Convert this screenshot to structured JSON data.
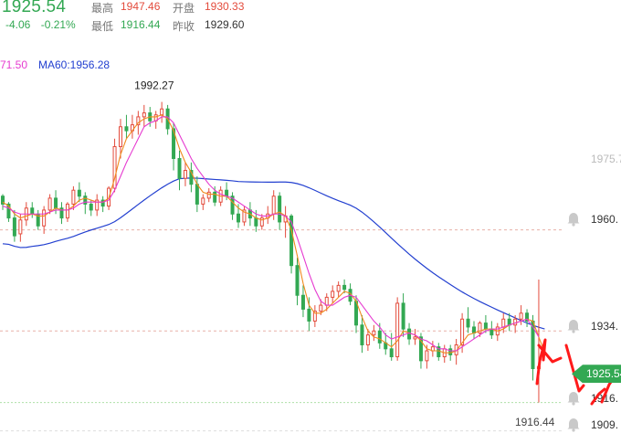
{
  "header": {
    "price": "1925.54",
    "change": "-4.06",
    "change_pct": "-0.21%",
    "high_label": "最高",
    "high": "1947.46",
    "low_label": "最低",
    "low": "1916.44",
    "open_label": "开盘",
    "open": "1930.33",
    "prev_close_label": "昨收",
    "prev_close": "1929.60"
  },
  "ma": {
    "ma_short_text": "71.50",
    "ma60_text": "MA60:1956.28"
  },
  "colors": {
    "up": "#e34b3c",
    "down": "#33a853",
    "ma_short": "#e63ad0",
    "ma_mid": "#f08a1e",
    "ma60": "#2340d0",
    "arrow": "#ff1a1a",
    "grid": "#e8b0a8",
    "bell": "#c9c9c9"
  },
  "chart_data": {
    "type": "candlestick",
    "y_range": [
      1906,
      2000
    ],
    "max_label": "1992.27",
    "min_label": "1916.44",
    "last_price_label": "1925.54",
    "right_axis_labels": [
      "1975.7",
      "1960.",
      "1934.",
      "1916.",
      "1909."
    ],
    "alert_levels": [
      1960.0,
      1934.5,
      1916.44,
      1909.3
    ],
    "candles": [
      [
        1968.5,
        1969,
        1965,
        1966.5
      ],
      [
        1966.5,
        1967,
        1962,
        1963
      ],
      [
        1963,
        1965,
        1957,
        1958.5
      ],
      [
        1959,
        1964,
        1957,
        1962.5
      ],
      [
        1962.5,
        1967,
        1961,
        1965.5
      ],
      [
        1965.5,
        1967,
        1963,
        1964
      ],
      [
        1964,
        1965,
        1960,
        1961
      ],
      [
        1961,
        1966,
        1959,
        1965
      ],
      [
        1965,
        1969,
        1964,
        1968
      ],
      [
        1968,
        1970,
        1964,
        1965.5
      ],
      [
        1965.5,
        1967,
        1961.5,
        1963
      ],
      [
        1963,
        1967,
        1962,
        1966.5
      ],
      [
        1966.5,
        1971,
        1965,
        1970
      ],
      [
        1970,
        1972,
        1967,
        1968.5
      ],
      [
        1968.5,
        1969.5,
        1964,
        1966.5
      ],
      [
        1966.5,
        1967.5,
        1963.5,
        1965
      ],
      [
        1965,
        1969,
        1963.5,
        1967.5
      ],
      [
        1967.5,
        1968.5,
        1964.5,
        1966
      ],
      [
        1966,
        1971,
        1965,
        1970.5
      ],
      [
        1970.5,
        1983,
        1969.5,
        1981
      ],
      [
        1981,
        1988,
        1978,
        1986
      ],
      [
        1986,
        1989,
        1983,
        1985
      ],
      [
        1985,
        1989,
        1983,
        1986.5
      ],
      [
        1986.5,
        1990,
        1984,
        1988.5
      ],
      [
        1988.5,
        1991.5,
        1986,
        1989.5
      ],
      [
        1989.5,
        1991,
        1986,
        1987.5
      ],
      [
        1987.5,
        1990,
        1985.5,
        1989
      ],
      [
        1989,
        1992.27,
        1987,
        1990.5
      ],
      [
        1990.5,
        1991.5,
        1984,
        1985.5
      ],
      [
        1985.5,
        1987,
        1975,
        1978
      ],
      [
        1978,
        1980,
        1970,
        1973
      ],
      [
        1973,
        1977,
        1971,
        1975
      ],
      [
        1975,
        1977,
        1969.5,
        1971.5
      ],
      [
        1971.5,
        1973.5,
        1964.5,
        1966.5
      ],
      [
        1966.5,
        1969,
        1965,
        1968
      ],
      [
        1968,
        1970.5,
        1967,
        1969.5
      ],
      [
        1969.5,
        1971,
        1966,
        1967
      ],
      [
        1967,
        1971,
        1966,
        1970
      ],
      [
        1970,
        1972,
        1967.5,
        1968.5
      ],
      [
        1968.5,
        1969.5,
        1962.5,
        1964
      ],
      [
        1964,
        1966.5,
        1960.5,
        1962
      ],
      [
        1962,
        1966,
        1961,
        1965
      ],
      [
        1965,
        1967,
        1961,
        1963
      ],
      [
        1963,
        1965,
        1959.5,
        1961
      ],
      [
        1961,
        1964,
        1960,
        1963
      ],
      [
        1963,
        1966,
        1961.5,
        1964
      ],
      [
        1964,
        1970,
        1962.5,
        1968.5
      ],
      [
        1968.5,
        1969.5,
        1960,
        1962
      ],
      [
        1962,
        1966,
        1958,
        1963.5
      ],
      [
        1963.5,
        1964,
        1949,
        1951
      ],
      [
        1951,
        1953,
        1941,
        1943.5
      ],
      [
        1943.5,
        1946,
        1938,
        1940
      ],
      [
        1940,
        1943,
        1934.5,
        1937
      ],
      [
        1937,
        1941,
        1935.5,
        1939.5
      ],
      [
        1939.5,
        1942.5,
        1938.5,
        1941
      ],
      [
        1941,
        1944,
        1939.5,
        1943
      ],
      [
        1943,
        1946,
        1941.5,
        1944.5
      ],
      [
        1944.5,
        1947,
        1943,
        1946
      ],
      [
        1946,
        1947.5,
        1944,
        1945
      ],
      [
        1945,
        1946.5,
        1941,
        1942
      ],
      [
        1942,
        1943.5,
        1934,
        1936
      ],
      [
        1936,
        1938.5,
        1929,
        1931
      ],
      [
        1931,
        1935,
        1929.5,
        1933.5
      ],
      [
        1933.5,
        1936,
        1932,
        1934.5
      ],
      [
        1934.5,
        1936.5,
        1930,
        1931.5
      ],
      [
        1931.5,
        1934,
        1928.5,
        1930
      ],
      [
        1930,
        1934,
        1927,
        1928
      ],
      [
        1928,
        1943,
        1927,
        1941.5
      ],
      [
        1941.5,
        1944,
        1933,
        1935
      ],
      [
        1935,
        1936.5,
        1931,
        1932.5
      ],
      [
        1932.5,
        1935,
        1931,
        1933
      ],
      [
        1933,
        1934,
        1925,
        1927
      ],
      [
        1927,
        1931,
        1925,
        1929.5
      ],
      [
        1929.5,
        1932,
        1928,
        1930.5
      ],
      [
        1930.5,
        1931.5,
        1927,
        1928
      ],
      [
        1928,
        1931,
        1926.5,
        1930
      ],
      [
        1930,
        1931,
        1927,
        1928.5
      ],
      [
        1928.5,
        1932.5,
        1926,
        1931
      ],
      [
        1931,
        1939,
        1929,
        1937.5
      ],
      [
        1937.5,
        1940.5,
        1934,
        1935.5
      ],
      [
        1935.5,
        1937,
        1932.5,
        1934
      ],
      [
        1934,
        1937,
        1933,
        1936.5
      ],
      [
        1936.5,
        1938.5,
        1934,
        1935
      ],
      [
        1935,
        1937,
        1932.5,
        1933.5
      ],
      [
        1933.5,
        1936.5,
        1932,
        1935.5
      ],
      [
        1935.5,
        1939,
        1934,
        1937.5
      ],
      [
        1937.5,
        1939,
        1934.5,
        1936
      ],
      [
        1936,
        1938.5,
        1934,
        1937.5
      ],
      [
        1937.5,
        1941,
        1936,
        1939
      ],
      [
        1939,
        1940,
        1935.5,
        1937
      ],
      [
        1937,
        1938.5,
        1922,
        1925
      ],
      [
        1925,
        1947.46,
        1916.44,
        1925.54
      ]
    ],
    "ma_short": [
      1966,
      1965.5,
      1964.5,
      1964,
      1964,
      1964,
      1964,
      1964,
      1964.5,
      1965,
      1965,
      1965,
      1965.5,
      1966.5,
      1967,
      1967,
      1967,
      1967,
      1967.5,
      1970,
      1973.5,
      1977,
      1980,
      1983,
      1986,
      1987,
      1987.5,
      1988.5,
      1988.5,
      1987,
      1984,
      1981,
      1978,
      1975.5,
      1973.5,
      1971.5,
      1970,
      1969,
      1968.5,
      1968,
      1967,
      1966,
      1965,
      1964,
      1963.5,
      1963.5,
      1964,
      1964,
      1963.5,
      1962,
      1958,
      1953.5,
      1949,
      1945,
      1942,
      1941,
      1941,
      1942,
      1943,
      1943.5,
      1943,
      1941,
      1939,
      1937,
      1935.5,
      1933.5,
      1932.5,
      1933,
      1933.5,
      1934,
      1933.5,
      1932.5,
      1932,
      1931,
      1930,
      1930,
      1929.5,
      1929.5,
      1930.5,
      1931.5,
      1932.5,
      1933.5,
      1934.5,
      1935,
      1935,
      1935.5,
      1936,
      1936.5,
      1937,
      1937.5,
      1935.5,
      1933
    ],
    "ma_mid": [
      1967,
      1966,
      1964,
      1963,
      1963.5,
      1964,
      1963.5,
      1963.5,
      1964.5,
      1965.5,
      1965,
      1965,
      1966,
      1967.5,
      1968,
      1967.5,
      1967,
      1967,
      1968,
      1973,
      1979,
      1983,
      1985,
      1987,
      1988,
      1988.5,
      1988.5,
      1989,
      1988,
      1985,
      1980.5,
      1977,
      1974.5,
      1971.5,
      1969.5,
      1969,
      1969,
      1968.5,
      1968.5,
      1967,
      1965.5,
      1964.5,
      1964,
      1963,
      1962.5,
      1963,
      1964,
      1964.5,
      1963.5,
      1960,
      1953.5,
      1946.5,
      1941,
      1939,
      1939,
      1940,
      1941.5,
      1943,
      1944.5,
      1944,
      1942,
      1938,
      1934.5,
      1933,
      1932.5,
      1931.5,
      1930.5,
      1932,
      1934.5,
      1934,
      1933.5,
      1932,
      1930,
      1929.5,
      1929.5,
      1929,
      1929,
      1929.5,
      1931.5,
      1933.5,
      1934,
      1934.5,
      1935,
      1935,
      1934.5,
      1935,
      1936,
      1936.5,
      1937,
      1937.5,
      1937,
      1933,
      1929
    ]
  }
}
